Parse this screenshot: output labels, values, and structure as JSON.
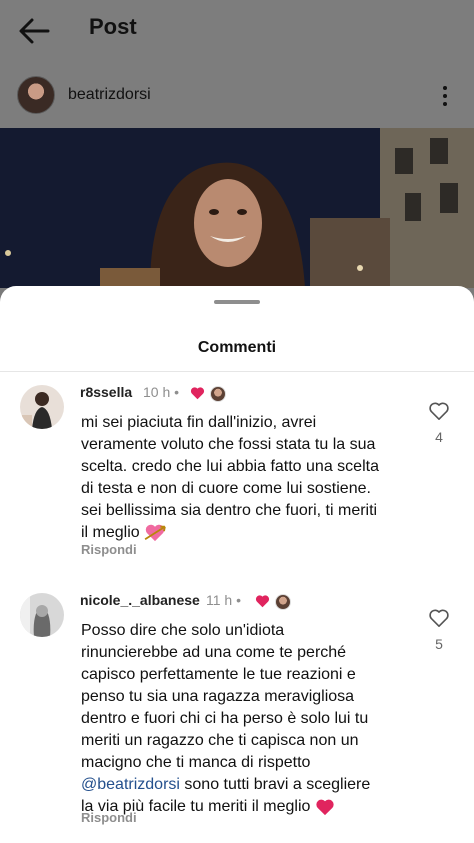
{
  "header": {
    "title": "Post"
  },
  "post": {
    "username": "beatrizdorsi"
  },
  "sheet": {
    "title": "Commenti"
  },
  "comments": [
    {
      "username": "r8ssella",
      "time": "10 h",
      "separator": "•",
      "lines": [
        "mi sei piaciuta fin dall'inizio, avrei",
        "veramente voluto che fossi stata tu la sua",
        "scelta. credo che lui abbia fatto una scelta",
        "di testa e non di cuore come lui sostiene.",
        "sei bellissima sia dentro che fuori, ti meriti",
        "il meglio"
      ],
      "reply_label": "Rispondi",
      "likes": "4"
    },
    {
      "username": "nicole_._albanese",
      "time": "11 h",
      "separator": "•",
      "lines": [
        "Posso dire che solo un'idiota",
        "rinuncierebbe ad una come te perché",
        "capisco perfettamente le tue reazioni e",
        "penso tu sia una ragazza meravigliosa",
        "dentro e fuori chi ci ha perso è solo lui tu",
        "meriti un ragazzo che ti capisca non un",
        "macigno che ti manca di rispetto"
      ],
      "mention": "@beatrizdorsi",
      "mention_rest": " sono tutti bravi a scegliere",
      "last_line": "la via più facile tu meriti il meglio",
      "reply_label": "Rispondi",
      "likes": "5"
    }
  ],
  "colors": {
    "mention": "#24508d",
    "heart_red": "#e0245e"
  },
  "icons": [
    "back-arrow-icon",
    "more-vertical-icon",
    "heart-icon",
    "heart-outline-icon",
    "heart-arrow-emoji"
  ]
}
